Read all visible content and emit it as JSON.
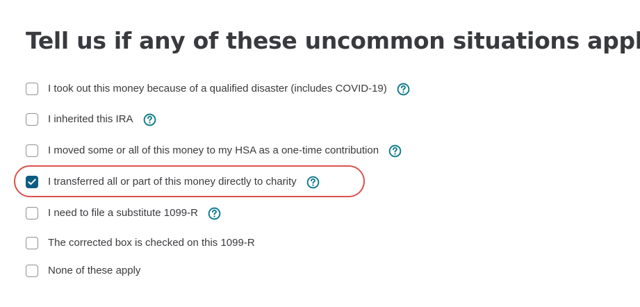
{
  "page": {
    "title": "Tell us if any of these uncommon situations apply"
  },
  "options": [
    {
      "label": "I took out this money because of a qualified disaster (includes COVID-19)",
      "checked": false,
      "has_help": true,
      "help_icon": "question-circle-icon"
    },
    {
      "label": "I inherited this IRA",
      "checked": false,
      "has_help": true,
      "help_icon": "question-circle-icon"
    },
    {
      "label": "I moved some or all of this money to my HSA as a one-time contribution",
      "checked": false,
      "has_help": true,
      "help_icon": "question-circle-icon"
    },
    {
      "label": "I transferred all or part of this money directly to charity",
      "checked": true,
      "has_help": true,
      "help_icon": "question-circle-icon"
    },
    {
      "label": "I need to file a substitute 1099-R",
      "checked": false,
      "has_help": true,
      "help_icon": "question-circle-icon"
    },
    {
      "label": "The corrected box is checked on this 1099-R",
      "checked": false,
      "has_help": false
    },
    {
      "label": "None of these apply",
      "checked": false,
      "has_help": false
    }
  ],
  "colors": {
    "text": "#393a3d",
    "checkbox_checked": "#0d5c82",
    "help_icon": "#0d7a8c",
    "highlight": "#d9534f"
  }
}
